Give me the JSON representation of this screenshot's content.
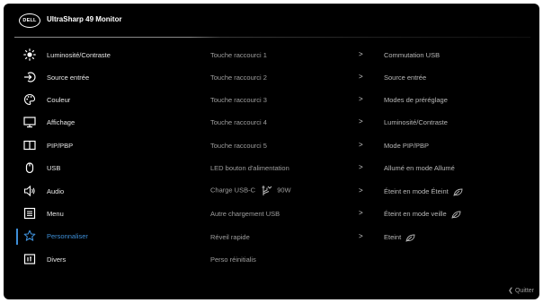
{
  "header": {
    "logo_text": "DELL",
    "title": "UltraSharp 49 Monitor"
  },
  "menu": [
    {
      "label": "Luminosité/Contraste",
      "icon": "brightness-icon"
    },
    {
      "label": "Source entrée",
      "icon": "input-source-icon"
    },
    {
      "label": "Couleur",
      "icon": "color-palette-icon"
    },
    {
      "label": "Affichage",
      "icon": "display-icon"
    },
    {
      "label": "PIP/PBP",
      "icon": "pip-pbp-icon"
    },
    {
      "label": "USB",
      "icon": "usb-mouse-icon"
    },
    {
      "label": "Audio",
      "icon": "speaker-icon"
    },
    {
      "label": "Menu",
      "icon": "menu-list-icon"
    },
    {
      "label": "Personnaliser",
      "icon": "star-icon",
      "selected": true
    },
    {
      "label": "Divers",
      "icon": "info-icon"
    }
  ],
  "settings": [
    {
      "name": "Touche raccourci 1",
      "value": "Commutation USB"
    },
    {
      "name": "Touche raccourci 2",
      "value": "Source entrée"
    },
    {
      "name": "Touche raccourci 3",
      "value": "Modes de préréglage"
    },
    {
      "name": "Touche raccourci 4",
      "value": "Luminosité/Contraste"
    },
    {
      "name": "Touche raccourci 5",
      "value": "Mode PIP/PBP"
    },
    {
      "name": "LED bouton d'alimentation",
      "value": "Allumé en mode Allumé"
    },
    {
      "name": "Charge USB-C",
      "power": "90W",
      "value": "Éteint en mode Éteint"
    },
    {
      "name": "Autre chargement USB",
      "value": "Éteint en mode veille"
    },
    {
      "name": "Réveil rapide",
      "value": "Eteint"
    },
    {
      "name": "Perso réinitialis"
    }
  ],
  "chevron": ">",
  "footer": {
    "exit_label": "Quitter",
    "exit_icon": "chevron-left-icon"
  },
  "colors": {
    "background": "#000000",
    "accent": "#3e8fd8",
    "text": "#e6e6e6",
    "muted": "#9e9e9e"
  }
}
